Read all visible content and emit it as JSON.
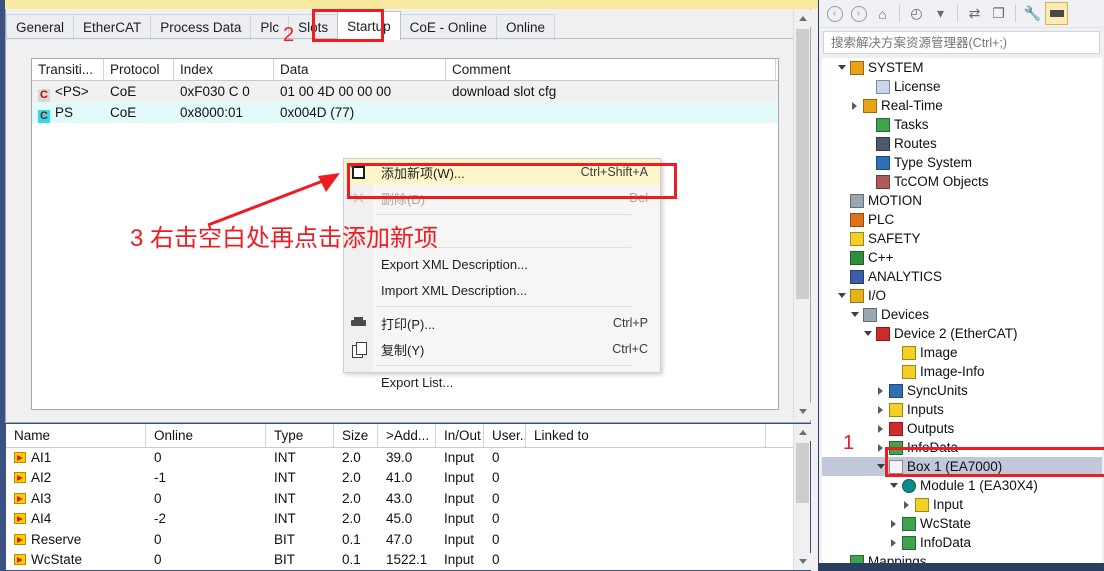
{
  "editor": {
    "tabs": [
      {
        "label": "General",
        "active": false
      },
      {
        "label": "EtherCAT",
        "active": false
      },
      {
        "label": "Process Data",
        "active": false
      },
      {
        "label": "Plc",
        "active": false
      },
      {
        "label": "Slots",
        "active": false
      },
      {
        "label": "Startup",
        "active": true
      },
      {
        "label": "CoE - Online",
        "active": false
      },
      {
        "label": "Online",
        "active": false
      }
    ],
    "startup_grid": {
      "columns": [
        "Transiti...",
        "Protocol",
        "Index",
        "Data",
        "Comment"
      ],
      "rows": [
        {
          "flag": "C",
          "flag_style": "grey",
          "transition": "<PS>",
          "protocol": "CoE",
          "index": "0xF030 C 0",
          "data": "01 00 4D 00 00 00",
          "comment": "download slot cfg"
        },
        {
          "flag": "C",
          "flag_style": "cyan",
          "transition": "PS",
          "protocol": "CoE",
          "index": "0x8000:01",
          "data": "0x004D (77)",
          "comment": ""
        }
      ]
    }
  },
  "context_menu": {
    "items": [
      {
        "label": "添加新项(W)...",
        "shortcut": "Ctrl+Shift+A",
        "icon": "new-item-icon",
        "state": "highlighted"
      },
      {
        "label": "删除(D)",
        "shortcut": "Del",
        "icon": "delete-x-icon",
        "state": "disabled"
      },
      {
        "separator": true
      },
      {
        "label": "",
        "shortcut": "",
        "icon": "",
        "state": "obscured"
      },
      {
        "separator": true
      },
      {
        "label": "Export XML Description...",
        "shortcut": "",
        "icon": "",
        "state": "normal"
      },
      {
        "label": "Import XML Description...",
        "shortcut": "",
        "icon": "",
        "state": "normal"
      },
      {
        "separator": true
      },
      {
        "label": "打印(P)...",
        "shortcut": "Ctrl+P",
        "icon": "print-icon",
        "state": "normal"
      },
      {
        "label": "复制(Y)",
        "shortcut": "Ctrl+C",
        "icon": "copy-icon",
        "state": "normal"
      },
      {
        "separator": true
      },
      {
        "label": "Export List...",
        "shortcut": "",
        "icon": "",
        "state": "normal"
      }
    ]
  },
  "annotations": {
    "step1": "1",
    "step2": "2",
    "step3": "3 右击空白处再点击添加新项",
    "color": "#ee1c23"
  },
  "variable_grid": {
    "columns": [
      "Name",
      "Online",
      "Type",
      "Size",
      ">Add...",
      "In/Out",
      "User...",
      "Linked to"
    ],
    "rows": [
      {
        "name": "AI1",
        "online": "0",
        "type": "INT",
        "size": "2.0",
        "addr": "39.0",
        "inout": "Input",
        "user": "0",
        "linked": ""
      },
      {
        "name": "AI2",
        "online": "-1",
        "type": "INT",
        "size": "2.0",
        "addr": "41.0",
        "inout": "Input",
        "user": "0",
        "linked": ""
      },
      {
        "name": "AI3",
        "online": "0",
        "type": "INT",
        "size": "2.0",
        "addr": "43.0",
        "inout": "Input",
        "user": "0",
        "linked": ""
      },
      {
        "name": "AI4",
        "online": "-2",
        "type": "INT",
        "size": "2.0",
        "addr": "45.0",
        "inout": "Input",
        "user": "0",
        "linked": ""
      },
      {
        "name": "Reserve",
        "online": "0",
        "type": "BIT",
        "size": "0.1",
        "addr": "47.0",
        "inout": "Input",
        "user": "0",
        "linked": ""
      },
      {
        "name": "WcState",
        "online": "0",
        "type": "BIT",
        "size": "0.1",
        "addr": "1522.1",
        "inout": "Input",
        "user": "0",
        "linked": ""
      }
    ]
  },
  "solution_explorer": {
    "toolbar": [
      {
        "name": "back-icon",
        "glyph": "←",
        "selected": false
      },
      {
        "name": "forward-icon",
        "glyph": "→",
        "selected": false
      },
      {
        "name": "home-icon",
        "glyph": "⌂",
        "selected": false
      },
      {
        "name": "pending-changes-icon",
        "glyph": "◴",
        "selected": false
      },
      {
        "name": "chevron-down-icon",
        "glyph": "▾",
        "selected": false
      },
      {
        "name": "sync-icon",
        "glyph": "⇄",
        "selected": false
      },
      {
        "name": "show-all-files-icon",
        "glyph": "❐",
        "selected": false
      },
      {
        "name": "properties-wrench-icon",
        "glyph": "🔧",
        "selected": false
      },
      {
        "name": "collapse-all-icon",
        "glyph": "▬",
        "selected": true
      }
    ],
    "search_placeholder": "搜索解决方案资源管理器(Ctrl+;)",
    "tree": [
      {
        "label": "SYSTEM",
        "indent": 1,
        "exp": "open",
        "icon": "system-icon",
        "color": "#e8a317",
        "selected": false
      },
      {
        "label": "License",
        "indent": 3,
        "exp": "none",
        "icon": "license-icon",
        "color": "#c9d7ea",
        "selected": false
      },
      {
        "label": "Real-Time",
        "indent": 2,
        "exp": "closed",
        "icon": "realtime-icon",
        "color": "#e8a317",
        "selected": false
      },
      {
        "label": "Tasks",
        "indent": 3,
        "exp": "none",
        "icon": "tasks-icon",
        "color": "#3fa34d",
        "selected": false
      },
      {
        "label": "Routes",
        "indent": 3,
        "exp": "none",
        "icon": "routes-icon",
        "color": "#4a5a6a",
        "selected": false
      },
      {
        "label": "Type System",
        "indent": 3,
        "exp": "none",
        "icon": "type-system-icon",
        "color": "#2f6fb5",
        "selected": false
      },
      {
        "label": "TcCOM Objects",
        "indent": 3,
        "exp": "none",
        "icon": "tccom-icon",
        "color": "#b05a5a",
        "selected": false
      },
      {
        "label": "MOTION",
        "indent": 1,
        "exp": "none",
        "icon": "motion-icon",
        "color": "#9aa6b2",
        "selected": false
      },
      {
        "label": "PLC",
        "indent": 1,
        "exp": "none",
        "icon": "plc-icon",
        "color": "#e0701a",
        "selected": false
      },
      {
        "label": "SAFETY",
        "indent": 1,
        "exp": "none",
        "icon": "safety-icon",
        "color": "#f2d024",
        "selected": false
      },
      {
        "label": "C++",
        "indent": 1,
        "exp": "none",
        "icon": "cpp-icon",
        "color": "#2f8f3f",
        "selected": false
      },
      {
        "label": "ANALYTICS",
        "indent": 1,
        "exp": "none",
        "icon": "analytics-icon",
        "color": "#3a5fa8",
        "selected": false
      },
      {
        "label": "I/O",
        "indent": 1,
        "exp": "open",
        "icon": "io-icon",
        "color": "#e8b21a",
        "selected": false
      },
      {
        "label": "Devices",
        "indent": 2,
        "exp": "open",
        "icon": "devices-icon",
        "color": "#9aa6b2",
        "selected": false
      },
      {
        "label": "Device 2 (EtherCAT)",
        "indent": 3,
        "exp": "open",
        "icon": "device-ethercat-icon",
        "color": "#cf2a2a",
        "selected": false
      },
      {
        "label": "Image",
        "indent": 5,
        "exp": "none",
        "icon": "image-icon",
        "color": "#f2d024",
        "selected": false
      },
      {
        "label": "Image-Info",
        "indent": 5,
        "exp": "none",
        "icon": "image-info-icon",
        "color": "#f2d024",
        "selected": false
      },
      {
        "label": "SyncUnits",
        "indent": 4,
        "exp": "closed",
        "icon": "syncunits-icon",
        "color": "#2f6fb5",
        "selected": false
      },
      {
        "label": "Inputs",
        "indent": 4,
        "exp": "closed",
        "icon": "inputs-icon",
        "color": "#f2d024",
        "selected": false
      },
      {
        "label": "Outputs",
        "indent": 4,
        "exp": "closed",
        "icon": "outputs-icon",
        "color": "#cf2a2a",
        "selected": false
      },
      {
        "label": "InfoData",
        "indent": 4,
        "exp": "closed",
        "icon": "infodata-icon",
        "color": "#3fa34d",
        "selected": false
      },
      {
        "label": "Box 1 (EA7000)",
        "indent": 4,
        "exp": "open",
        "icon": "box-icon",
        "color": "#e8e8e8",
        "selected": true
      },
      {
        "label": "Module 1 (EA30X4)",
        "indent": 5,
        "exp": "open",
        "icon": "module-icon",
        "color": "#0f8a8a",
        "selected": false
      },
      {
        "label": "Input",
        "indent": 6,
        "exp": "closed",
        "icon": "input-icon",
        "color": "#f2d024",
        "selected": false
      },
      {
        "label": "WcState",
        "indent": 5,
        "exp": "closed",
        "icon": "wcstate-icon",
        "color": "#3fa34d",
        "selected": false
      },
      {
        "label": "InfoData",
        "indent": 5,
        "exp": "closed",
        "icon": "infodata-icon",
        "color": "#3fa34d",
        "selected": false
      },
      {
        "label": "Mappings",
        "indent": 1,
        "exp": "none",
        "icon": "mappings-icon",
        "color": "#3fa34d",
        "selected": false
      }
    ]
  }
}
